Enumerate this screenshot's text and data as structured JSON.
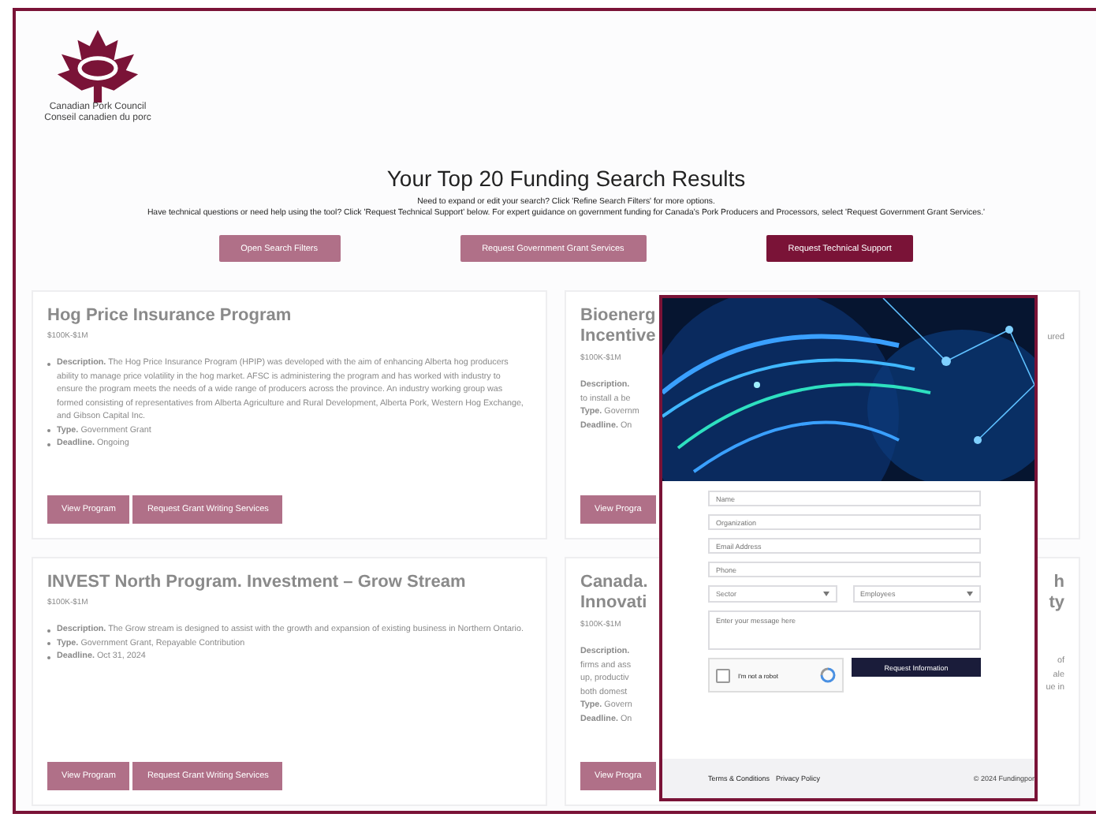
{
  "logo": {
    "lines": [
      "Canadian Pork Council",
      "Conseil canadien du porc"
    ]
  },
  "heading": "Your Top 20 Funding Search Results",
  "intro": [
    "Need to expand or edit your search? Click 'Refine Search Filters' for more options.",
    "Have technical questions or need help using the tool? Click 'Request Technical Support' below. For expert guidance on government funding for Canada's Pork Producers and Processors, select 'Request Government Grant Services.'"
  ],
  "actions": [
    {
      "label": "Open Search Filters",
      "disabled": true
    },
    {
      "label": "Request Government Grant Services",
      "disabled": true
    },
    {
      "label": "Request Technical Support",
      "disabled": false
    }
  ],
  "programs": [
    {
      "kind": "full",
      "title": "Hog Price Insurance Program",
      "amount": "$100K-$1M",
      "details": [
        {
          "label": "Description.",
          "text": "The Hog Price Insurance Program (HPIP) was developed with the aim of enhancing Alberta hog producers ability to manage price volatility in the hog market. AFSC is administering the program and has worked with industry to ensure the program meets the needs of a wide range of producers across the province. An industry working group was formed consisting of representatives from Alberta Agriculture and Rural Development, Alberta Pork, Western Hog Exchange, and Gibson Capital Inc."
        },
        {
          "label": "Type.",
          "text": "Government Grant"
        },
        {
          "label": "Deadline.",
          "text": "Ongoing"
        }
      ],
      "buttons": [
        "View Program",
        "Request Grant Writing Services"
      ]
    },
    {
      "kind": "covered",
      "title_lines": [
        "Bioenerg",
        "Incentive"
      ],
      "amount": "$100K-$1M",
      "lines": [
        "**Description.**",
        "to install a be",
        "**Type.** Governm",
        "**Deadline.** On"
      ],
      "body_tails": [
        "ured"
      ],
      "buttons": [
        "View Progra"
      ]
    },
    {
      "kind": "full",
      "title": "INVEST North Program. Investment – Grow Stream",
      "amount": "$100K-$1M",
      "details": [
        {
          "label": "Description.",
          "text": "The Grow stream is designed to assist with the growth and expansion of existing business in Northern Ontario."
        },
        {
          "label": "Type.",
          "text": "Government Grant, Repayable Contribution"
        },
        {
          "label": "Deadline.",
          "text": "Oct 31, 2024"
        }
      ],
      "buttons": [
        "View Program",
        "Request Grant Writing Services"
      ]
    },
    {
      "kind": "covered",
      "title_lines": [
        "Canada.",
        "Innovati"
      ],
      "amount": "$100K-$1M",
      "lines": [
        "**Description.**",
        "firms and ass",
        "up, productiv",
        "both domest",
        "**Type.** Govern",
        "**Deadline.** On"
      ],
      "title_tails": [
        "h",
        "ty"
      ],
      "body_tails": [
        "of",
        "ale",
        "ue in"
      ],
      "buttons": [
        "View Progra"
      ]
    }
  ],
  "modal": {
    "open": true,
    "fields": [
      {
        "kind": "input",
        "placeholder": "Name"
      },
      {
        "kind": "input",
        "placeholder": "Organization"
      },
      {
        "kind": "input",
        "placeholder": "Email Address"
      },
      {
        "kind": "input",
        "placeholder": "Phone"
      },
      {
        "kind": "select",
        "placeholder": "Sector"
      },
      {
        "kind": "select",
        "placeholder": "Employees"
      },
      {
        "kind": "textarea",
        "placeholder": "Enter your message here"
      }
    ],
    "captcha": {
      "label": "I'm not a robot",
      "checked": false
    },
    "submit": "Request Information",
    "footer_links": [
      "Terms & Conditions",
      "Privacy Policy"
    ],
    "copyright": "© 2024 Fundingpor"
  }
}
